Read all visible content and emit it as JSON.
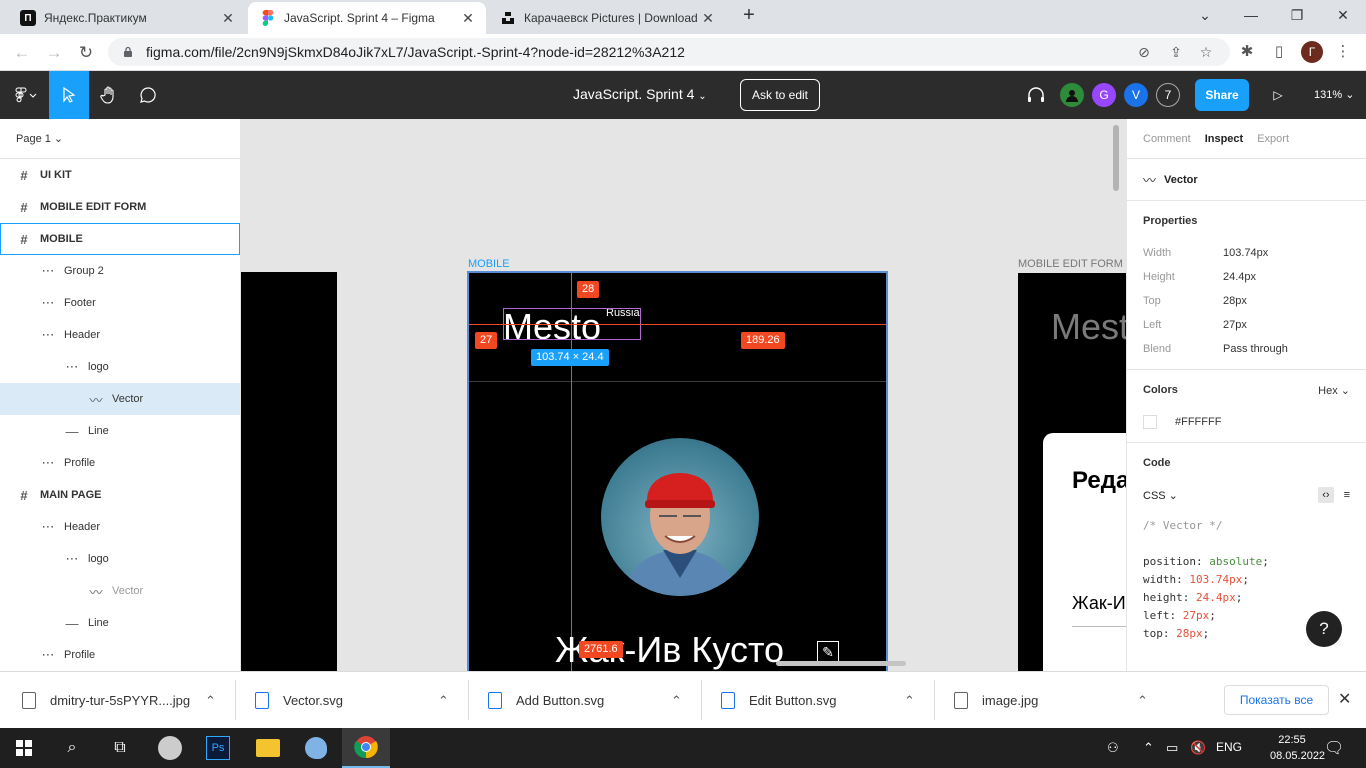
{
  "browser": {
    "tabs": [
      {
        "title": "Яндекс.Практикум",
        "favicon": "praktikum-icon",
        "active": false
      },
      {
        "title": "JavaScript. Sprint 4 – Figma",
        "favicon": "figma-icon",
        "active": true
      },
      {
        "title": "Карачаевск Pictures | Download",
        "favicon": "unsplash-icon",
        "active": false
      }
    ],
    "url": "figma.com/file/2cn9N9jSkmxD84oJik7xL7/JavaScript.-Sprint-4?node-id=28212%3A212",
    "profile_initial": "Г"
  },
  "figma": {
    "doc_title": "JavaScript. Sprint 4",
    "ask_to_edit": "Ask to edit",
    "avatars": [
      {
        "initial": "",
        "color": "#2e8b3a"
      },
      {
        "initial": "G",
        "color": "#9747ff"
      },
      {
        "initial": "V",
        "color": "#1a73e8"
      },
      {
        "initial": "7",
        "color": "#2c2c2c"
      }
    ],
    "share": "Share",
    "zoom": "131%"
  },
  "layers": {
    "page": "Page 1",
    "items": [
      {
        "label": "UI KIT",
        "kind": "frame",
        "indent": 0
      },
      {
        "label": "MOBILE EDIT FORM",
        "kind": "frame",
        "indent": 0
      },
      {
        "label": "MOBILE",
        "kind": "frame",
        "indent": 0,
        "outlined": true
      },
      {
        "label": "Group 2",
        "kind": "group",
        "indent": 1
      },
      {
        "label": "Footer",
        "kind": "group",
        "indent": 1
      },
      {
        "label": "Header",
        "kind": "group",
        "indent": 1
      },
      {
        "label": "logo",
        "kind": "group",
        "indent": 2
      },
      {
        "label": "Vector",
        "kind": "vector",
        "indent": 3,
        "selected": true
      },
      {
        "label": "Line",
        "kind": "line",
        "indent": 2
      },
      {
        "label": "Profile",
        "kind": "group",
        "indent": 1
      },
      {
        "label": "MAIN PAGE",
        "kind": "frame",
        "indent": 0
      },
      {
        "label": "Header",
        "kind": "group",
        "indent": 1
      },
      {
        "label": "logo",
        "kind": "group",
        "indent": 2
      },
      {
        "label": "Vector",
        "kind": "vector",
        "indent": 3,
        "grey": true
      },
      {
        "label": "Line",
        "kind": "line",
        "indent": 2
      },
      {
        "label": "Profile",
        "kind": "group",
        "indent": 1
      }
    ]
  },
  "canvas": {
    "mobile_label": "MOBILE",
    "edit_form_label": "MOBILE EDIT FORM",
    "logo_text": "Mesto",
    "logo_sub": "Russia",
    "measure_top": "28",
    "measure_left": "27",
    "measure_right": "189.26",
    "measure_bottom": "2761.6",
    "size_badge": "103.74 × 24.4",
    "profile_name": "Жак-Ив Кусто",
    "edit_popup_title": "Реда",
    "edit_popup_input": "Жак-И"
  },
  "inspect": {
    "tabs": [
      "Comment",
      "Inspect",
      "Export"
    ],
    "active_tab": "Inspect",
    "selected_name": "Vector",
    "properties_title": "Properties",
    "properties": [
      {
        "k": "Width",
        "v": "103.74px"
      },
      {
        "k": "Height",
        "v": "24.4px"
      },
      {
        "k": "Top",
        "v": "28px"
      },
      {
        "k": "Left",
        "v": "27px"
      },
      {
        "k": "Blend",
        "v": "Pass through"
      }
    ],
    "colors_title": "Colors",
    "color_format": "Hex",
    "color_value": "#FFFFFF",
    "code_title": "Code",
    "code_lang": "CSS",
    "code_comment": "/* Vector */",
    "code": [
      {
        "prop": "position",
        "val": "absolute",
        "type": "kw"
      },
      {
        "prop": "width",
        "val": "103.74px",
        "type": "n"
      },
      {
        "prop": "height",
        "val": "24.4px",
        "type": "n"
      },
      {
        "prop": "left",
        "val": "27px",
        "type": "n"
      },
      {
        "prop": "top",
        "val": "28px",
        "type": "n"
      }
    ]
  },
  "downloads": {
    "items": [
      {
        "name": "dmitry-tur-5sPYYR....jpg",
        "icon": "image-file-icon"
      },
      {
        "name": "Vector.svg",
        "icon": "svg-file-icon"
      },
      {
        "name": "Add Button.svg",
        "icon": "svg-file-icon"
      },
      {
        "name": "Edit Button.svg",
        "icon": "svg-file-icon"
      },
      {
        "name": "image.jpg",
        "icon": "image-file-icon"
      }
    ],
    "show_all": "Показать все"
  },
  "taskbar": {
    "lang": "ENG",
    "time": "22:55",
    "date": "08.05.2022"
  }
}
